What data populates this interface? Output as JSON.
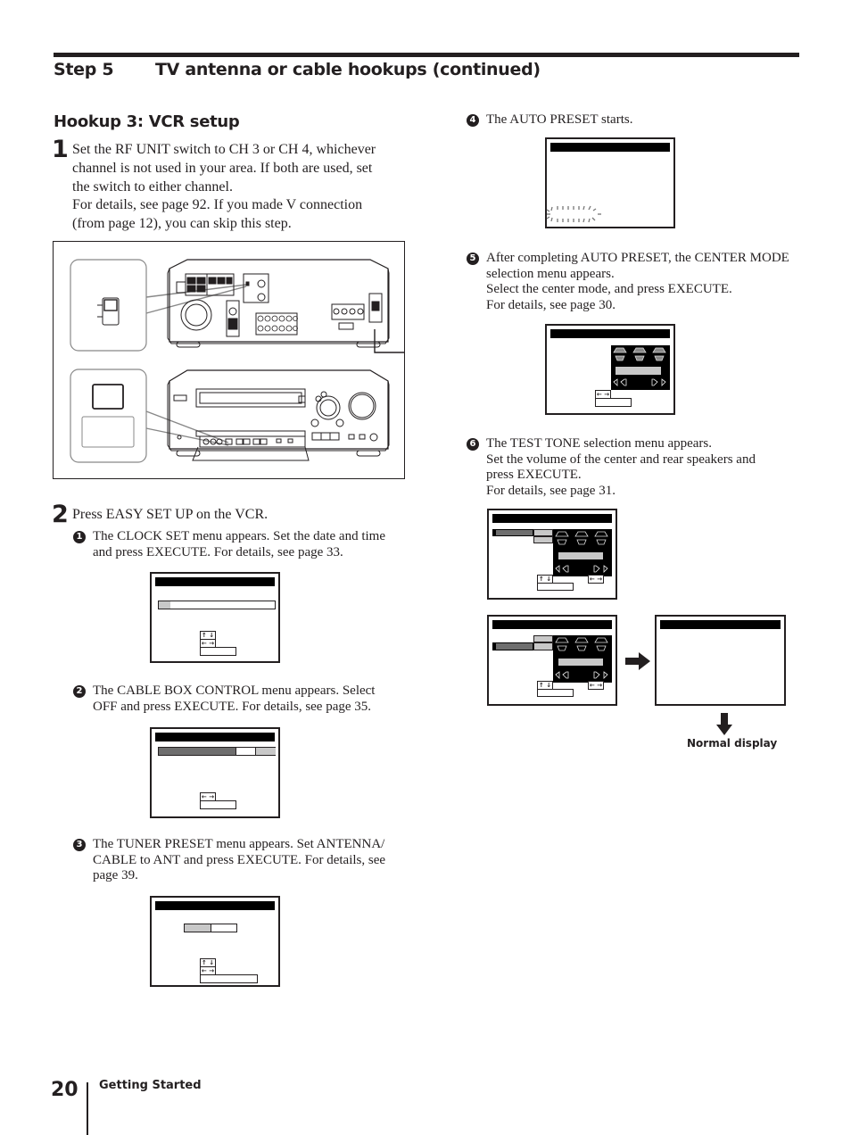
{
  "header": {
    "step_number": "Step 5",
    "step_title": "TV antenna or cable hookups (continued)"
  },
  "section": {
    "title": "Hookup 3:  VCR setup"
  },
  "step1": {
    "number": "1",
    "lines": [
      "Set the RF UNIT switch to CH 3 or CH 4, whichever",
      "channel is not used in your area. If both are used, set",
      "the switch to either channel.",
      "For details, see page 92. If you made V connection",
      "(from page 12), you can skip this step."
    ]
  },
  "step2": {
    "number": "2",
    "text": "Press EASY SET UP on the VCR.",
    "substeps": [
      {
        "badge": "1",
        "lines": [
          "The CLOCK SET menu appears. Set the date and time",
          "and press EXECUTE.  For details, see page 33."
        ]
      },
      {
        "badge": "2",
        "lines": [
          "The CABLE BOX CONTROL menu appears. Select",
          "OFF and press EXECUTE.  For details, see page 35."
        ]
      },
      {
        "badge": "3",
        "lines": [
          "The TUNER PRESET menu appears. Set ANTENNA/",
          "CABLE to ANT and press EXECUTE. For details, see",
          "page 39."
        ]
      },
      {
        "badge": "4",
        "lines": [
          "The AUTO PRESET starts."
        ]
      },
      {
        "badge": "5",
        "lines": [
          "After completing AUTO PRESET, the CENTER MODE",
          "selection menu appears.",
          "Select the center mode, and press EXECUTE.",
          "For details, see page 30."
        ]
      },
      {
        "badge": "6",
        "lines": [
          "The TEST TONE selection menu appears.",
          "Set the volume of the center and rear speakers and",
          "press EXECUTE.",
          "For details, see page 31."
        ]
      }
    ]
  },
  "icons": {
    "updown": "↑ ↓",
    "leftright": "← →",
    "arrow_right": "arrow-right-icon",
    "arrow_down": "arrow-down-icon"
  },
  "normal_display_label": "Normal display",
  "footer": {
    "page_number": "20",
    "section_label": "Getting Started"
  }
}
